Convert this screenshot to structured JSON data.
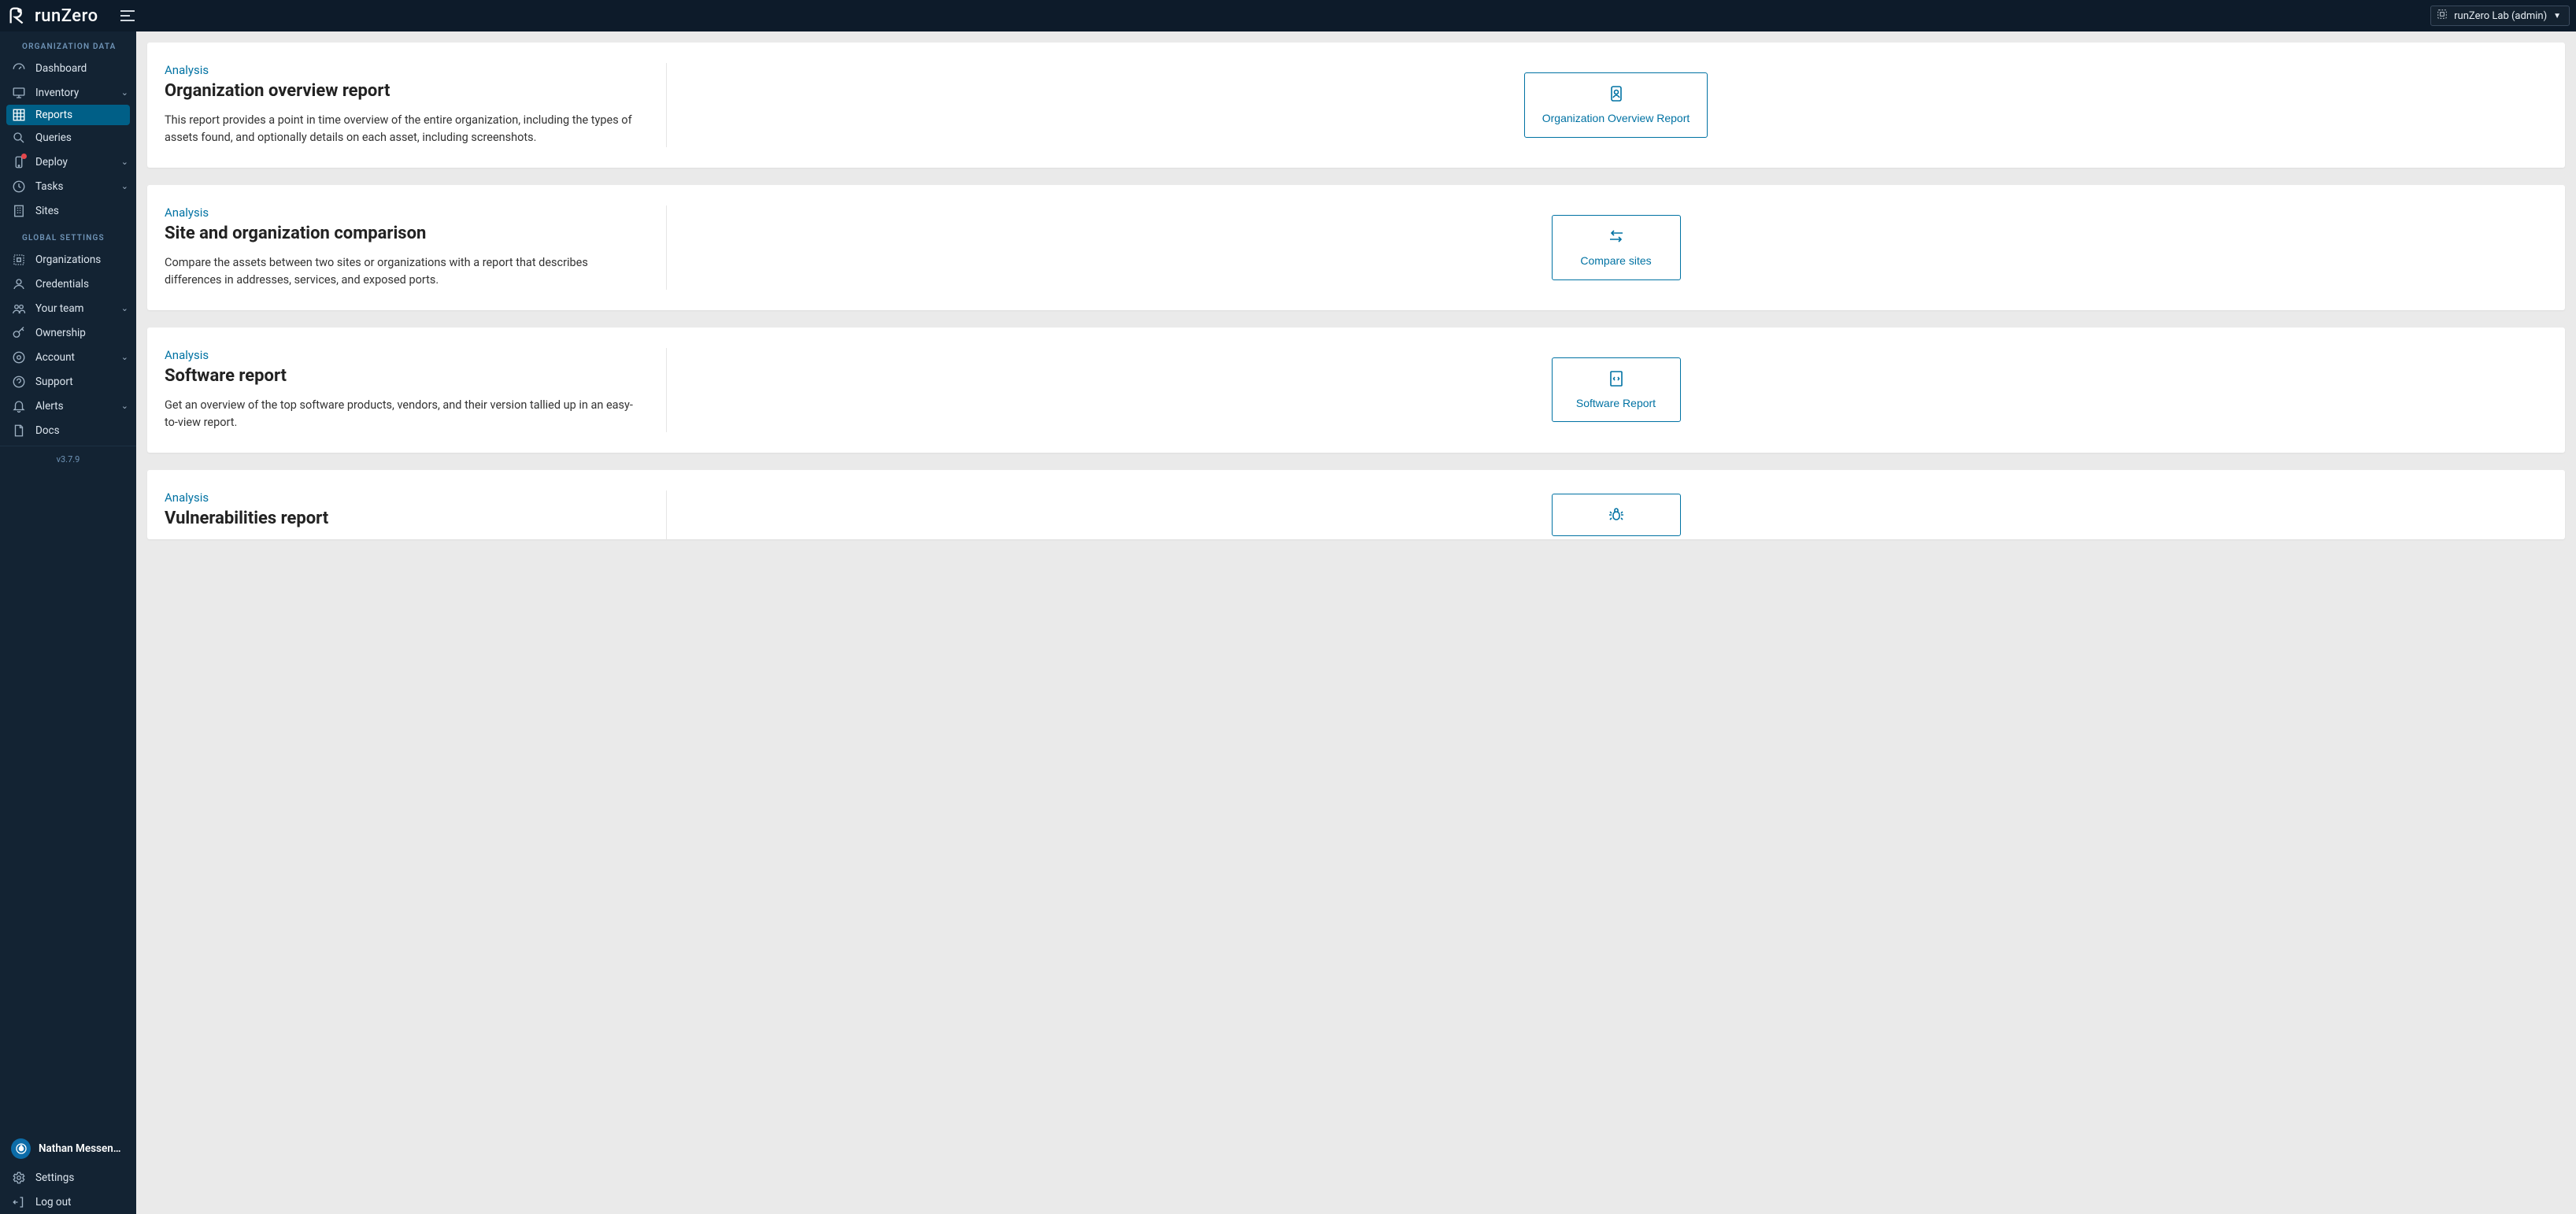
{
  "app": {
    "name": "runZero",
    "version": "v3.7.9",
    "org_switcher_label": "runZero Lab (admin)"
  },
  "sidebar": {
    "section_org": "ORGANIZATION DATA",
    "section_global": "GLOBAL SETTINGS",
    "items": {
      "dashboard": "Dashboard",
      "inventory": "Inventory",
      "reports": "Reports",
      "queries": "Queries",
      "deploy": "Deploy",
      "tasks": "Tasks",
      "sites": "Sites",
      "organizations": "Organizations",
      "credentials": "Credentials",
      "your_team": "Your team",
      "ownership": "Ownership",
      "account": "Account",
      "support": "Support",
      "alerts": "Alerts",
      "docs": "Docs",
      "settings": "Settings",
      "logout": "Log out"
    },
    "user_name": "Nathan Messenger"
  },
  "reports": [
    {
      "overline": "Analysis",
      "title": "Organization overview report",
      "desc": "This report provides a point in time overview of the entire organization, including the types of assets found, and optionally details on each asset, including screenshots.",
      "button": "Organization Overview Report"
    },
    {
      "overline": "Analysis",
      "title": "Site and organization comparison",
      "desc": "Compare the assets between two sites or organizations with a report that describes differences in addresses, services, and exposed ports.",
      "button": "Compare sites"
    },
    {
      "overline": "Analysis",
      "title": "Software report",
      "desc": "Get an overview of the top software products, vendors, and their version tallied up in an easy-to-view report.",
      "button": "Software Report"
    },
    {
      "overline": "Analysis",
      "title": "Vulnerabilities report",
      "desc": "",
      "button": ""
    }
  ]
}
